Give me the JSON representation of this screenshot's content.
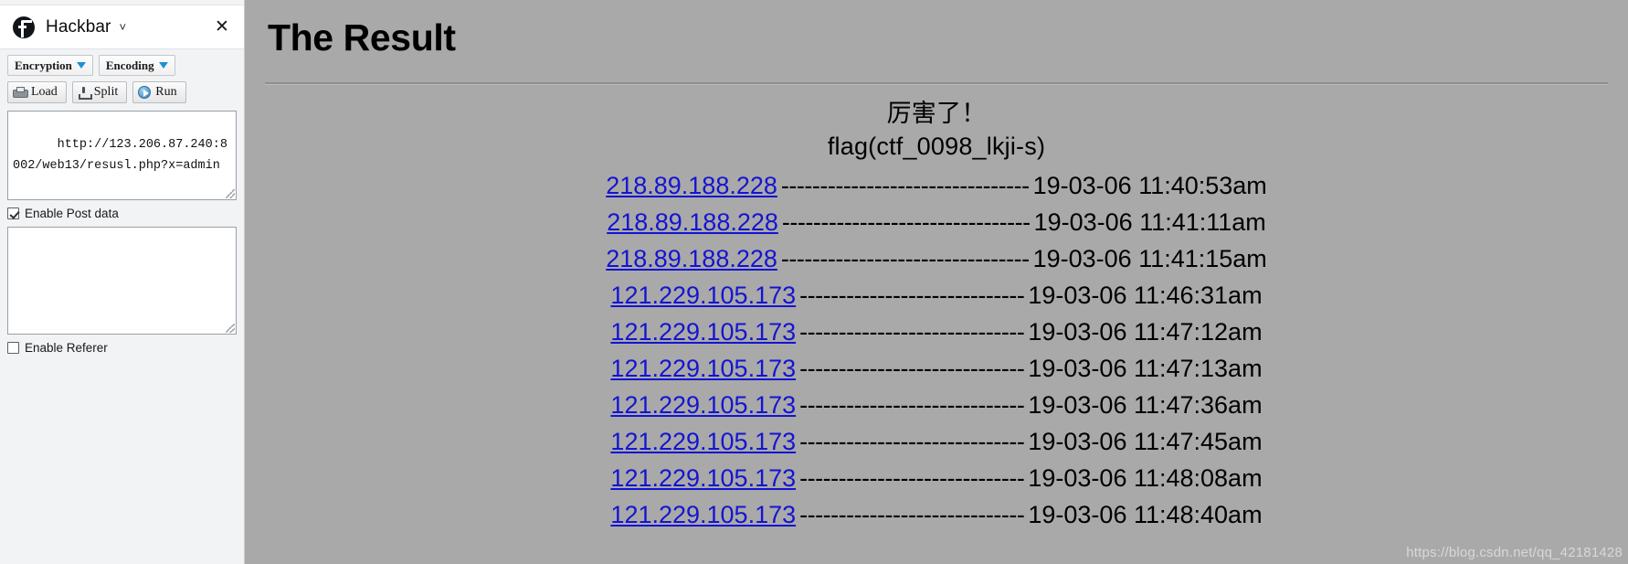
{
  "hackbar": {
    "title": "Hackbar",
    "dropdown_caret": "˅",
    "close_label": "✕",
    "icon_name": "firefox-icon",
    "toolbar": {
      "encryption_label": "Encryption",
      "encoding_label": "Encoding",
      "load_label": "Load",
      "split_label": "Split",
      "run_label": "Run"
    },
    "url_value": "http://123.206.87.240:8002/web13/resusl.php?x=admin",
    "post_data_checkbox": {
      "label": "Enable Post data",
      "checked": true
    },
    "post_data_value": "",
    "referer_checkbox": {
      "label": "Enable Referer",
      "checked": false
    }
  },
  "page": {
    "title": "The Result",
    "message_cn": "厉害了！",
    "flag": "flag(ctf_0098_lkji-s)",
    "separator": "--------------------------------",
    "watermark": "https://blog.csdn.net/qq_42181428",
    "link_color": "#1414d2",
    "background_color": "#a9a9a9",
    "rows": [
      {
        "ip": "218.89.188.228",
        "sep": "--------------------------------",
        "timestamp": "19-03-06 11:40:53am"
      },
      {
        "ip": "218.89.188.228",
        "sep": "--------------------------------",
        "timestamp": "19-03-06 11:41:11am"
      },
      {
        "ip": "218.89.188.228",
        "sep": "--------------------------------",
        "timestamp": "19-03-06 11:41:15am"
      },
      {
        "ip": "121.229.105.173",
        "sep": "-----------------------------",
        "timestamp": "19-03-06 11:46:31am"
      },
      {
        "ip": "121.229.105.173",
        "sep": "-----------------------------",
        "timestamp": "19-03-06 11:47:12am"
      },
      {
        "ip": "121.229.105.173",
        "sep": "-----------------------------",
        "timestamp": "19-03-06 11:47:13am"
      },
      {
        "ip": "121.229.105.173",
        "sep": "-----------------------------",
        "timestamp": "19-03-06 11:47:36am"
      },
      {
        "ip": "121.229.105.173",
        "sep": "-----------------------------",
        "timestamp": "19-03-06 11:47:45am"
      },
      {
        "ip": "121.229.105.173",
        "sep": "-----------------------------",
        "timestamp": "19-03-06 11:48:08am"
      },
      {
        "ip": "121.229.105.173",
        "sep": "-----------------------------",
        "timestamp": "19-03-06 11:48:40am"
      }
    ]
  }
}
